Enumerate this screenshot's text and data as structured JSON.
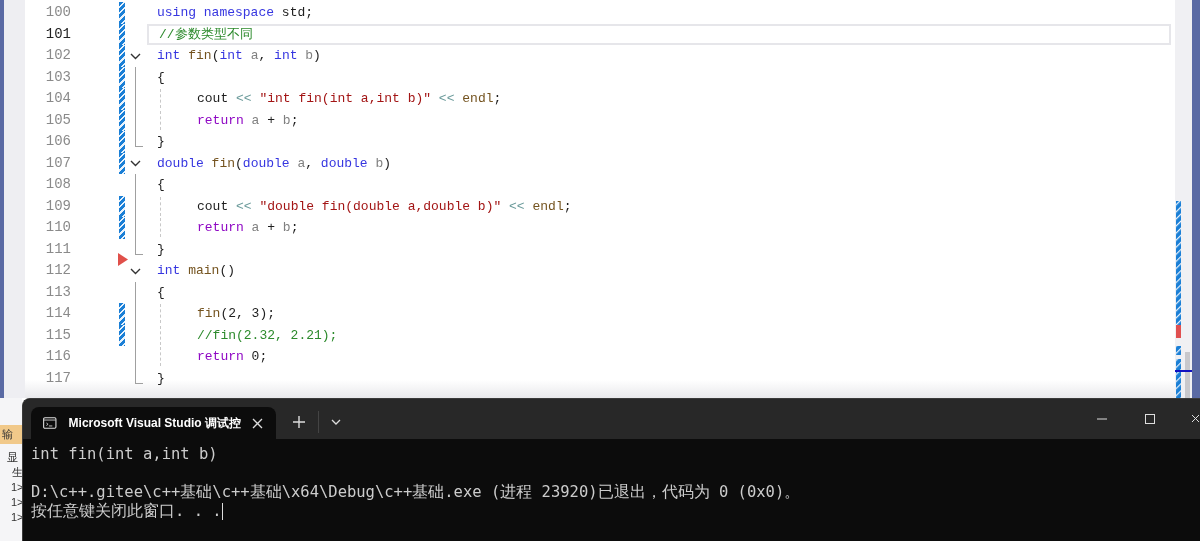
{
  "editor": {
    "lines": [
      {
        "number": "100",
        "current": false,
        "changed": true,
        "run_marker": false,
        "indented": false,
        "fold_toggle": false,
        "fold_guide": false,
        "fold_end": false,
        "tokens": [
          {
            "kind": "kw",
            "text": "using namespace "
          },
          {
            "kind": "plain",
            "text": "std;"
          }
        ]
      },
      {
        "number": "101",
        "current": true,
        "changed": true,
        "run_marker": false,
        "indented": false,
        "fold_toggle": false,
        "fold_guide": false,
        "fold_end": false,
        "tokens": [
          {
            "kind": "cmt",
            "text": "//参数类型不同"
          }
        ]
      },
      {
        "number": "102",
        "current": false,
        "changed": true,
        "run_marker": false,
        "indented": false,
        "fold_toggle": true,
        "expanded": true,
        "fold_guide": false,
        "fold_end": false,
        "tokens": [
          {
            "kind": "kw",
            "text": "int "
          },
          {
            "kind": "fn",
            "text": "fin"
          },
          {
            "kind": "plain",
            "text": "("
          },
          {
            "kind": "kw",
            "text": "int "
          },
          {
            "kind": "param",
            "text": "a"
          },
          {
            "kind": "plain",
            "text": ", "
          },
          {
            "kind": "kw",
            "text": "int "
          },
          {
            "kind": "param",
            "text": "b"
          },
          {
            "kind": "plain",
            "text": ")"
          }
        ]
      },
      {
        "number": "103",
        "current": false,
        "changed": true,
        "run_marker": false,
        "indented": false,
        "fold_toggle": false,
        "fold_guide": true,
        "fold_end": false,
        "tokens": [
          {
            "kind": "plain",
            "text": "{"
          }
        ]
      },
      {
        "number": "104",
        "current": false,
        "changed": true,
        "run_marker": false,
        "indented": true,
        "fold_toggle": false,
        "fold_guide": true,
        "fold_end": false,
        "tokens": [
          {
            "kind": "plain",
            "text": "cout "
          },
          {
            "kind": "op",
            "text": "<< "
          },
          {
            "kind": "str",
            "text": "\"int fin(int a,int b)\""
          },
          {
            "kind": "op",
            "text": " << "
          },
          {
            "kind": "fn",
            "text": "endl"
          },
          {
            "kind": "plain",
            "text": ";"
          }
        ]
      },
      {
        "number": "105",
        "current": false,
        "changed": true,
        "run_marker": false,
        "indented": true,
        "fold_toggle": false,
        "fold_guide": true,
        "fold_end": false,
        "tokens": [
          {
            "kind": "ctl",
            "text": "return "
          },
          {
            "kind": "param",
            "text": "a"
          },
          {
            "kind": "plain",
            "text": " + "
          },
          {
            "kind": "param",
            "text": "b"
          },
          {
            "kind": "plain",
            "text": ";"
          }
        ]
      },
      {
        "number": "106",
        "current": false,
        "changed": true,
        "run_marker": false,
        "indented": false,
        "fold_toggle": false,
        "fold_guide": false,
        "fold_end": true,
        "tokens": [
          {
            "kind": "plain",
            "text": "}"
          }
        ]
      },
      {
        "number": "107",
        "current": false,
        "changed": true,
        "run_marker": false,
        "indented": false,
        "fold_toggle": true,
        "expanded": true,
        "fold_guide": false,
        "fold_end": false,
        "tokens": [
          {
            "kind": "kw",
            "text": "double "
          },
          {
            "kind": "fn",
            "text": "fin"
          },
          {
            "kind": "plain",
            "text": "("
          },
          {
            "kind": "kw",
            "text": "double "
          },
          {
            "kind": "param",
            "text": "a"
          },
          {
            "kind": "plain",
            "text": ", "
          },
          {
            "kind": "kw",
            "text": "double "
          },
          {
            "kind": "param",
            "text": "b"
          },
          {
            "kind": "plain",
            "text": ")"
          }
        ]
      },
      {
        "number": "108",
        "current": false,
        "changed": false,
        "run_marker": false,
        "indented": false,
        "fold_toggle": false,
        "fold_guide": true,
        "fold_end": false,
        "tokens": [
          {
            "kind": "plain",
            "text": "{"
          }
        ]
      },
      {
        "number": "109",
        "current": false,
        "changed": true,
        "run_marker": false,
        "indented": true,
        "fold_toggle": false,
        "fold_guide": true,
        "fold_end": false,
        "tokens": [
          {
            "kind": "plain",
            "text": "cout "
          },
          {
            "kind": "op",
            "text": "<< "
          },
          {
            "kind": "str",
            "text": "\"double fin(double a,double b)\""
          },
          {
            "kind": "op",
            "text": " << "
          },
          {
            "kind": "fn",
            "text": "endl"
          },
          {
            "kind": "plain",
            "text": ";"
          }
        ]
      },
      {
        "number": "110",
        "current": false,
        "changed": true,
        "run_marker": false,
        "indented": true,
        "fold_toggle": false,
        "fold_guide": true,
        "fold_end": false,
        "tokens": [
          {
            "kind": "ctl",
            "text": "return "
          },
          {
            "kind": "param",
            "text": "a"
          },
          {
            "kind": "plain",
            "text": " + "
          },
          {
            "kind": "param",
            "text": "b"
          },
          {
            "kind": "plain",
            "text": ";"
          }
        ]
      },
      {
        "number": "111",
        "current": false,
        "changed": false,
        "run_marker": false,
        "indented": false,
        "fold_toggle": false,
        "fold_guide": false,
        "fold_end": true,
        "tokens": [
          {
            "kind": "plain",
            "text": "}"
          }
        ]
      },
      {
        "number": "112",
        "current": false,
        "changed": false,
        "run_marker": true,
        "indented": false,
        "fold_toggle": true,
        "expanded": true,
        "fold_guide": false,
        "fold_end": false,
        "tokens": [
          {
            "kind": "kw",
            "text": "int "
          },
          {
            "kind": "fn",
            "text": "main"
          },
          {
            "kind": "plain",
            "text": "()"
          }
        ]
      },
      {
        "number": "113",
        "current": false,
        "changed": false,
        "run_marker": false,
        "indented": false,
        "fold_toggle": false,
        "fold_guide": true,
        "fold_end": false,
        "tokens": [
          {
            "kind": "plain",
            "text": "{"
          }
        ]
      },
      {
        "number": "114",
        "current": false,
        "changed": true,
        "run_marker": false,
        "indented": true,
        "fold_toggle": false,
        "fold_guide": true,
        "fold_end": false,
        "tokens": [
          {
            "kind": "fn",
            "text": "fin"
          },
          {
            "kind": "plain",
            "text": "(2, 3);"
          }
        ]
      },
      {
        "number": "115",
        "current": false,
        "changed": true,
        "run_marker": false,
        "indented": true,
        "fold_toggle": false,
        "fold_guide": true,
        "fold_end": false,
        "tokens": [
          {
            "kind": "cmt",
            "text": "//fin(2.32, 2.21);"
          }
        ]
      },
      {
        "number": "116",
        "current": false,
        "changed": false,
        "run_marker": false,
        "indented": true,
        "fold_toggle": false,
        "fold_guide": true,
        "fold_end": false,
        "tokens": [
          {
            "kind": "ctl",
            "text": "return "
          },
          {
            "kind": "plain",
            "text": "0;"
          }
        ]
      },
      {
        "number": "117",
        "current": false,
        "changed": false,
        "run_marker": false,
        "indented": false,
        "fold_toggle": false,
        "fold_guide": false,
        "fold_end": true,
        "tokens": [
          {
            "kind": "plain",
            "text": "}"
          }
        ]
      }
    ]
  },
  "output_panel": {
    "tab": "输",
    "lines": [
      "显",
      "生",
      "1>",
      "1>",
      "1>"
    ]
  },
  "terminal": {
    "tab": {
      "title": "Microsoft Visual Studio 调试控",
      "selected": true
    },
    "lines": [
      {
        "text": "int fin(int a,int b)",
        "blank_before": false,
        "cursor": false
      },
      {
        "text": "D:\\c++.gitee\\c++基础\\c++基础\\x64\\Debug\\c++基础.exe (进程 23920)已退出，代码为 0 (0x0)。",
        "blank_before": true,
        "cursor": false
      },
      {
        "text": "按任意键关闭此窗口. . .",
        "blank_before": false,
        "cursor": true
      }
    ]
  }
}
